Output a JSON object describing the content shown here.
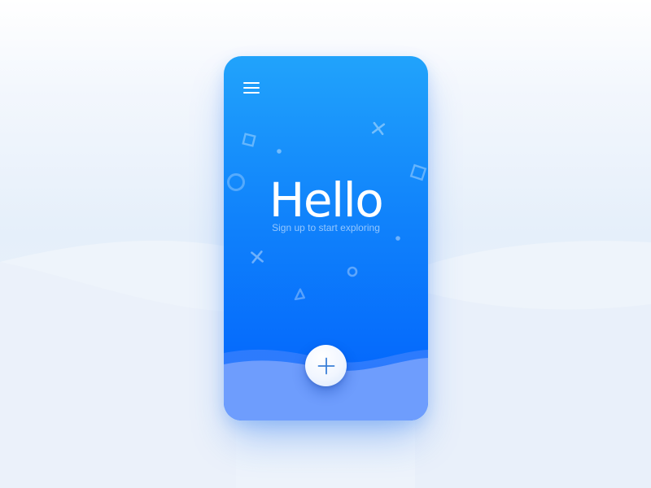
{
  "card": {
    "greeting": "Hello",
    "subtitle": "Sign up to start exploring"
  },
  "icons": {
    "menu": "hamburger-menu-icon",
    "add": "plus-icon",
    "decorations": [
      "square-outline",
      "cross",
      "circle-outline",
      "triangle-outline",
      "dot"
    ]
  },
  "colors": {
    "card_top": "#21a3fb",
    "card_bottom": "#0060fc",
    "wave_fill": "#6d9cfd",
    "icon_accent": "#3a7fd8",
    "background": "#e8f0fa"
  }
}
